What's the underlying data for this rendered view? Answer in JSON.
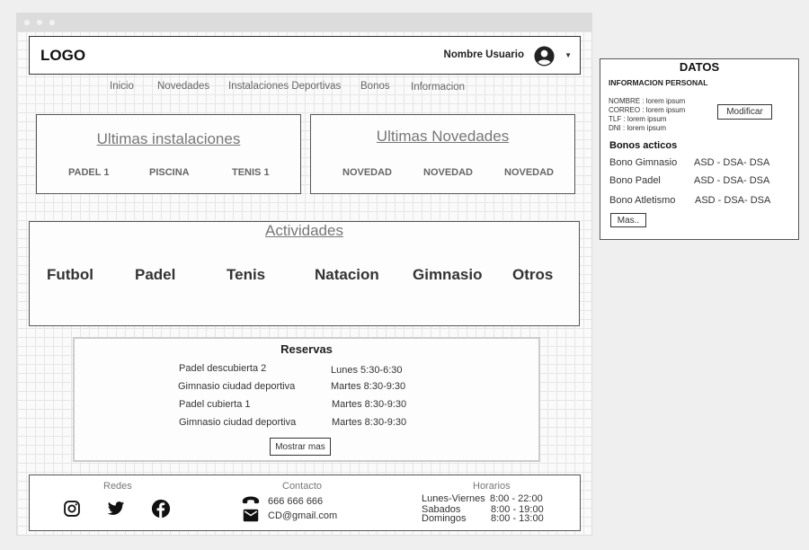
{
  "header": {
    "logo": "LOGO",
    "username": "Nombre Usuario",
    "avatar_icon": "user-circle-icon",
    "dropdown_icon": "caret-down-icon"
  },
  "nav": [
    "Inicio",
    "Novedades",
    "Instalaciones Deportivas",
    "Bonos",
    "Informacion"
  ],
  "instalaciones": {
    "title": "Ultimas instalaciones",
    "items": [
      "PADEL 1",
      "PISCINA",
      "TENIS 1"
    ]
  },
  "novedades": {
    "title": "Ultimas Novedades",
    "items": [
      "NOVEDAD",
      "NOVEDAD",
      "NOVEDAD"
    ]
  },
  "actividades": {
    "title": "Actividades",
    "items": [
      "Futbol",
      "Padel",
      "Tenis",
      "Natacion",
      "Gimnasio",
      "Otros"
    ]
  },
  "reservas": {
    "title": "Reservas",
    "rows": [
      {
        "place": "Padel descubierta 2",
        "time": "Lunes 5:30-6:30"
      },
      {
        "place": "Gimnasio ciudad deportiva",
        "time": "Martes 8:30-9:30"
      },
      {
        "place": "Padel cubierta 1",
        "time": "Martes 8:30-9:30"
      },
      {
        "place": "Gimnasio ciudad deportiva",
        "time": "Martes 8:30-9:30"
      }
    ],
    "more_label": "Mostrar mas"
  },
  "footer": {
    "redes_title": "Redes",
    "social_icons": [
      "instagram-icon",
      "twitter-icon",
      "facebook-icon"
    ],
    "contacto_title": "Contacto",
    "phone": "666 666 666",
    "email": "CD@gmail.com",
    "horarios_title": "Horarios",
    "horarios": [
      {
        "days": "Lunes-Viernes",
        "hours": "8:00 - 22:00"
      },
      {
        "days": "Sabados",
        "hours": "8:00 - 19:00"
      },
      {
        "days": "Domingos",
        "hours": "8:00 - 13:00"
      }
    ]
  },
  "datos": {
    "title": "DATOS",
    "subtitle": "INFORMACION PERSONAL",
    "fields": [
      "NOMBRE : lorem ipsum",
      "CORREO : lorem ipsum",
      "TLF : lorem ipsum",
      "DNI : lorem ipsum"
    ],
    "modify_label": "Modificar",
    "bonos_title": "Bonos acticos",
    "bonos": [
      {
        "name": "Bono Gimnasio",
        "value": "ASD - DSA- DSA"
      },
      {
        "name": "Bono Padel",
        "value": "ASD - DSA- DSA"
      },
      {
        "name": "Bono Atletismo",
        "value": "ASD - DSA- DSA"
      }
    ],
    "more_label": "Mas.."
  }
}
